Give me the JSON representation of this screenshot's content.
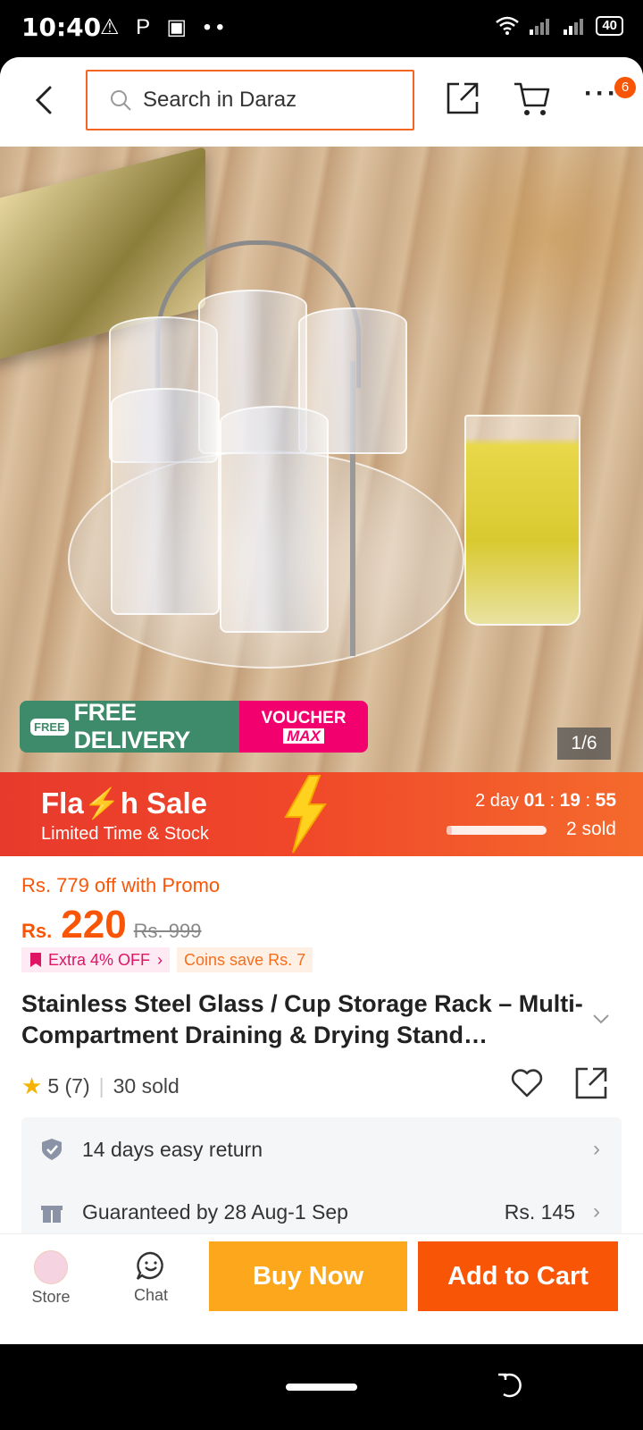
{
  "status_bar": {
    "time": "10:40",
    "left_icons": "⚠ P ▣ ••",
    "battery": "40"
  },
  "header": {
    "search_placeholder": "Search in Daraz",
    "cart_badge": "6"
  },
  "gallery": {
    "page_indicator": "1/6",
    "promo_free_icon_text": "FREE",
    "promo_free_label": "FREE DELIVERY",
    "promo_voucher_line1": "VOUCHER",
    "promo_voucher_line2": "MAX"
  },
  "flash_sale": {
    "title": "Fla⚡h Sale",
    "subtitle": "Limited Time & Stock",
    "timer_days": "2 day",
    "timer_hh": "01",
    "timer_mm": "19",
    "timer_ss": "55",
    "sold": "2 sold",
    "sold_progress": 0.05
  },
  "pricing": {
    "promo_off": "Rs. 779 off with Promo",
    "currency": "Rs.",
    "price": "220",
    "original_price": "Rs. 999",
    "tag_extra": "Extra 4% OFF",
    "tag_coins": "Coins save Rs. 7"
  },
  "product": {
    "title": "Stainless Steel Glass / Cup Storage Rack – Multi-Compartment Draining & Drying Stand…",
    "rating": "5",
    "reviews": "(7)",
    "sold": "30 sold"
  },
  "services": [
    {
      "label": "14 days easy return",
      "fee": ""
    },
    {
      "label": "Guaranteed by 28 Aug-1 Sep",
      "fee": "Rs. 145"
    }
  ],
  "bottom_bar": {
    "store_label": "Store",
    "chat_label": "Chat",
    "buy_now": "Buy Now",
    "add_to_cart": "Add to Cart"
  },
  "colors": {
    "accent": "#f85606",
    "buy_now": "#fca71c",
    "flash": "#e83a2c"
  }
}
